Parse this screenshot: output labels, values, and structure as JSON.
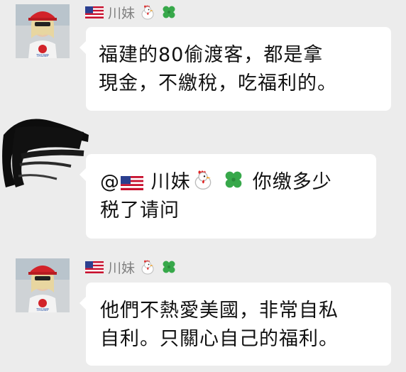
{
  "messages": [
    {
      "sender": "川妹",
      "text_lines": [
        "福建的80偷渡客，都是拿",
        "現金，不繳稅，吃福利的。"
      ]
    },
    {
      "mention": "@",
      "mention_name": "川妹",
      "text_line1": "你缴多少",
      "text_line2": "税了请问"
    },
    {
      "sender": "川妹",
      "text_lines": [
        "他們不熱愛美國，非常自私",
        "自利。只關心自己的福利。"
      ]
    }
  ],
  "icons": [
    "us-flag-icon",
    "rooster-icon",
    "shamrock-icon"
  ],
  "colors": {
    "background": "#ececec",
    "bubble": "#ffffff",
    "sender_name": "#7f7f7f"
  }
}
